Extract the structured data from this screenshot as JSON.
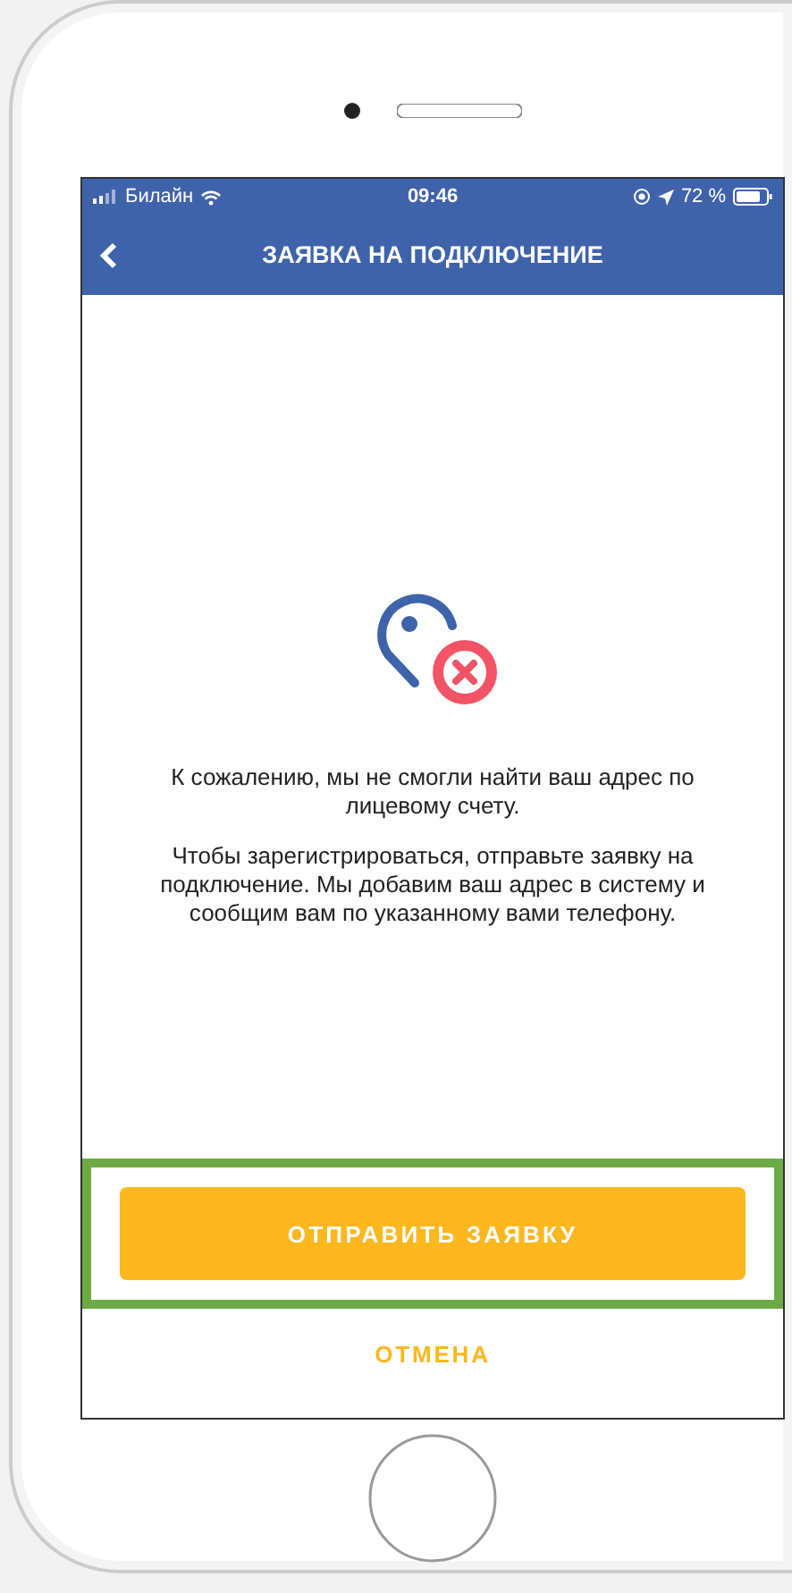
{
  "status_bar": {
    "carrier": "Билайн",
    "time": "09:46",
    "battery": "72 %"
  },
  "nav_bar": {
    "title": "ЗАЯВКА НА ПОДКЛЮЧЕНИЕ"
  },
  "message": [
    "К сожалению, мы не смогли найти ваш адрес по лицевому счету.",
    "Чтобы зарегистрироваться, отправьте заявку на подключение. Мы добавим ваш адрес в систему и сообщим вам по указанному вами телефону."
  ],
  "actions": [
    {
      "kind": "primary",
      "label": "ОТПРАВИТЬ ЗАЯВКУ",
      "highlighted": true
    },
    {
      "kind": "link",
      "label": "ОТМЕНА",
      "highlighted": false
    }
  ]
}
